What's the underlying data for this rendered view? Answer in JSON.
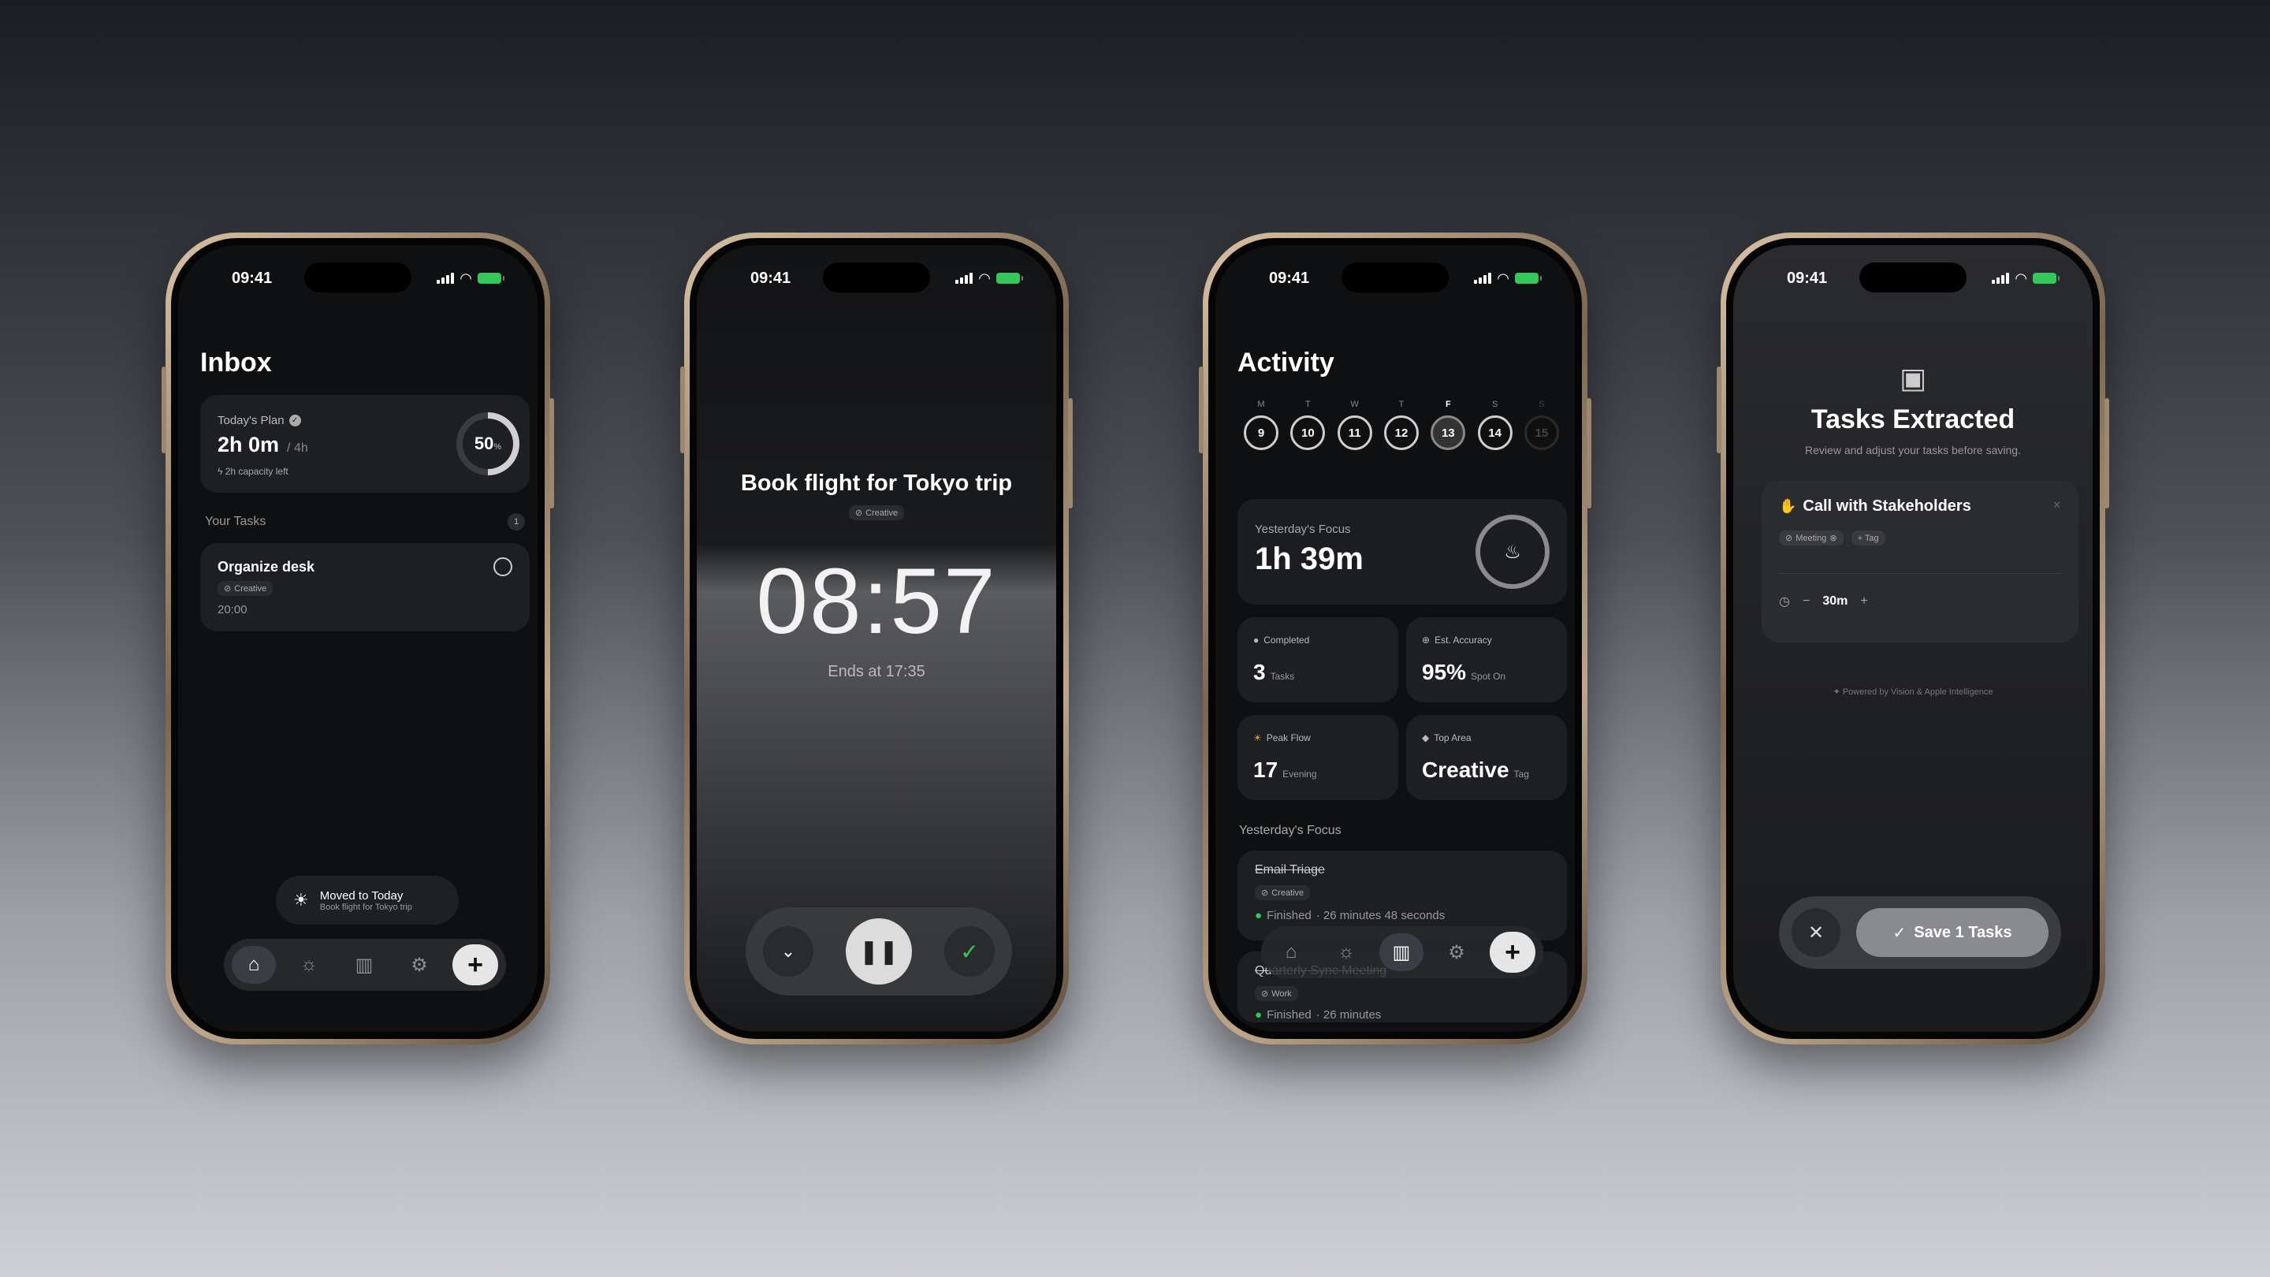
{
  "status_time": "09:41",
  "inbox": {
    "title": "Inbox",
    "plan_label": "Today's Plan",
    "plan_value": "2h 0m",
    "plan_total": "/ 4h",
    "capacity": "2h capacity left",
    "ring_value": "50",
    "ring_unit": "%",
    "ring_fraction": 0.5,
    "section_label": "Your Tasks",
    "section_count": "1",
    "task_title": "Organize desk",
    "task_tag": "Creative",
    "task_time": "20:00",
    "toast_title": "Moved to Today",
    "toast_sub": "Book flight for Tokyo trip"
  },
  "timer": {
    "task": "Book flight for Tokyo trip",
    "tag": "Creative",
    "clock": "08:57",
    "ends": "Ends at 17:35"
  },
  "activity": {
    "title": "Activity",
    "days": [
      {
        "d": "M",
        "n": "9"
      },
      {
        "d": "T",
        "n": "10"
      },
      {
        "d": "W",
        "n": "11"
      },
      {
        "d": "T",
        "n": "12"
      },
      {
        "d": "F",
        "n": "13"
      },
      {
        "d": "S",
        "n": "14"
      },
      {
        "d": "S",
        "n": "15"
      }
    ],
    "focus_label": "Yesterday's Focus",
    "focus_value": "1h 39m",
    "stats": {
      "completed_label": "Completed",
      "completed_value": "3",
      "completed_unit": "Tasks",
      "accuracy_label": "Est. Accuracy",
      "accuracy_value": "95%",
      "accuracy_unit": "Spot On",
      "peak_label": "Peak Flow",
      "peak_value": "17",
      "peak_unit": "Evening",
      "area_label": "Top Area",
      "area_value": "Creative",
      "area_unit": "Tag"
    },
    "section_label": "Yesterday's Focus",
    "item1_title": "Email Triage",
    "item1_tag": "Creative",
    "item1_status": "Finished",
    "item1_detail": "· 26 minutes 48 seconds",
    "item2_title": "Quarterly Sync Meeting",
    "item2_tag": "Work",
    "item2_status": "Finished",
    "item2_detail": "· 26 minutes"
  },
  "extract": {
    "title": "Tasks Extracted",
    "subtitle": "Review and adjust your tasks before saving.",
    "task_title": "Call with Stakeholders",
    "tag1": "Meeting",
    "tag2": "+ Tag",
    "duration": "30m",
    "powered": "Powered by Vision & Apple Intelligence",
    "save_label": "Save 1 Tasks"
  },
  "colors": {
    "accent_green": "#34c759",
    "card": "#1d1f22"
  }
}
